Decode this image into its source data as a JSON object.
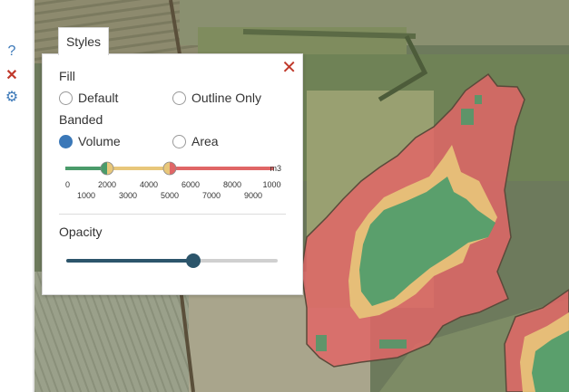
{
  "rail": {
    "help_icon": "?",
    "close_icon": "✕",
    "gear_icon": "⚙"
  },
  "panel": {
    "tab_label": "Styles",
    "close_icon": "✕",
    "fill_heading": "Fill",
    "fill_options": [
      "Default",
      "Outline Only"
    ],
    "banded_heading": "Banded",
    "banded_options": [
      "Volume",
      "Area"
    ],
    "banded_selected": "Volume",
    "scale_unit": "m3",
    "scale_ticks_top": [
      "0",
      "2000",
      "4000",
      "6000",
      "8000",
      "10000"
    ],
    "scale_ticks_bottom": [
      "1000",
      "3000",
      "5000",
      "7000",
      "9000"
    ],
    "scale_thresholds": [
      2000,
      5000
    ],
    "scale_max": 10000,
    "opacity_heading": "Opacity",
    "opacity_value": 0.6
  },
  "colors": {
    "green": "#4a9b6a",
    "yellow": "#e8c77a",
    "red": "#e06666",
    "accent": "#3b78b8"
  }
}
